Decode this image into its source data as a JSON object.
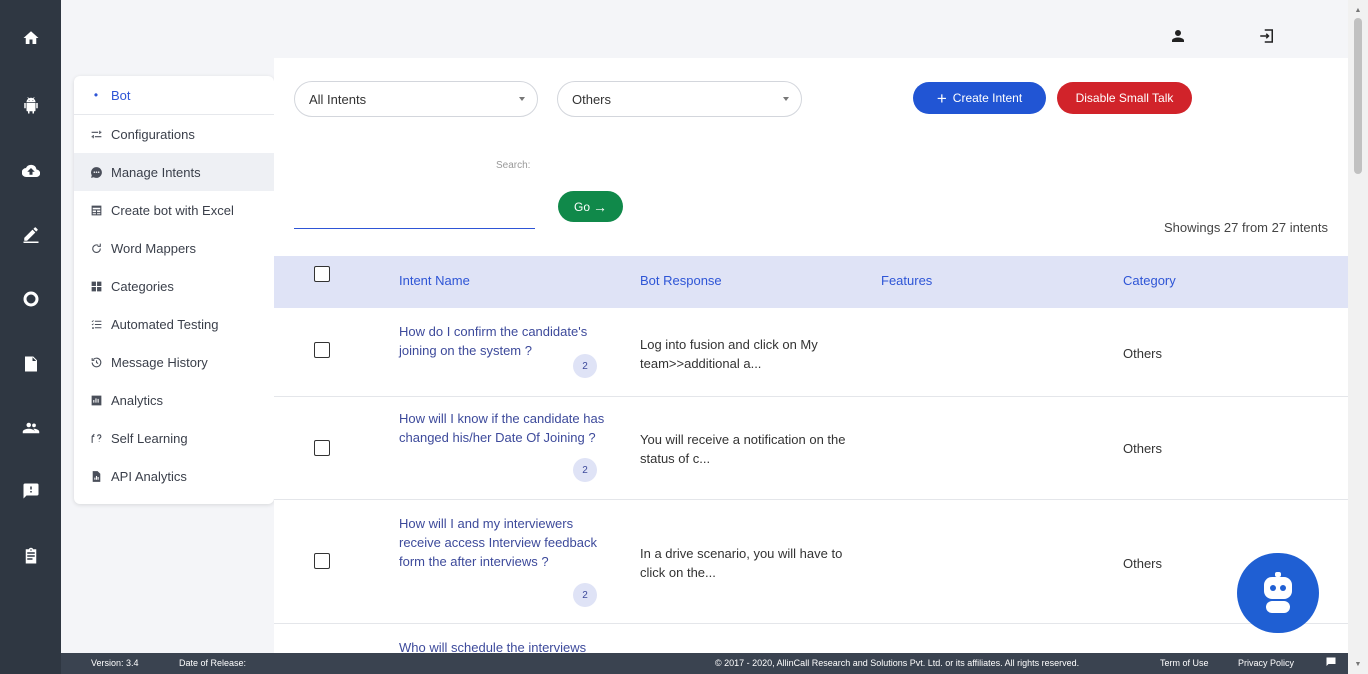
{
  "rail": {
    "icons": [
      "home-icon",
      "android-icon",
      "cloud-upload-icon",
      "edit-icon",
      "circle-icon",
      "file-icon",
      "users-icon",
      "feedback-icon",
      "clipboard-icon"
    ]
  },
  "menu": {
    "items": [
      {
        "label": "Bot",
        "icon": "bullet-icon"
      },
      {
        "label": "Configurations",
        "icon": "sliders-icon"
      },
      {
        "label": "Manage Intents",
        "icon": "chat-icon"
      },
      {
        "label": "Create bot with Excel",
        "icon": "table-icon"
      },
      {
        "label": "Word Mappers",
        "icon": "word-mapper-icon"
      },
      {
        "label": "Categories",
        "icon": "grid-icon"
      },
      {
        "label": "Automated Testing",
        "icon": "checklist-icon"
      },
      {
        "label": "Message History",
        "icon": "history-icon"
      },
      {
        "label": "Analytics",
        "icon": "analytics-icon"
      },
      {
        "label": "Self Learning",
        "icon": "self-learning-icon"
      },
      {
        "label": "API Analytics",
        "icon": "api-analytics-icon"
      }
    ]
  },
  "filters": {
    "intent_filter": "All Intents",
    "category_filter": "Others"
  },
  "actions": {
    "create_intent": "Create Intent",
    "disable_small_talk": "Disable Small Talk",
    "go": "Go"
  },
  "search": {
    "label": "Search:",
    "value": ""
  },
  "summary": "Showings 27 from 27 intents",
  "table": {
    "headers": [
      "Intent Name",
      "Bot Response",
      "Features",
      "Category"
    ],
    "rows": [
      {
        "intent": "How do I confirm the candidate's joining on the system ?",
        "count": "2",
        "response": "Log into fusion and click on My team>>additional a...",
        "category": "Others"
      },
      {
        "intent": "How will I know if the candidate has changed his/her Date Of Joining ?",
        "count": "2",
        "response": "You will receive a notification on the status of c...",
        "category": "Others"
      },
      {
        "intent": "How will I and my interviewers receive access Interview feedback form the after interviews ?",
        "count": "2",
        "response": "In a drive scenario, you will have to click on the...",
        "category": "Others"
      },
      {
        "intent": "Who will schedule the interviews",
        "count": "",
        "response": "",
        "category": ""
      }
    ]
  },
  "footer": {
    "version": "Version: 3.4",
    "release": "Date of Release:",
    "copyright": "© 2017 - 2020, AllinCall Research and Solutions Pvt. Ltd. or its affiliates. All rights reserved.",
    "terms": "Term of Use",
    "privacy": "Privacy Policy"
  },
  "colors": {
    "rail": "#2f3742",
    "primary": "#2155d4",
    "danger": "#d1232a",
    "success": "#10894a",
    "table_header": "#dfe3f6"
  }
}
